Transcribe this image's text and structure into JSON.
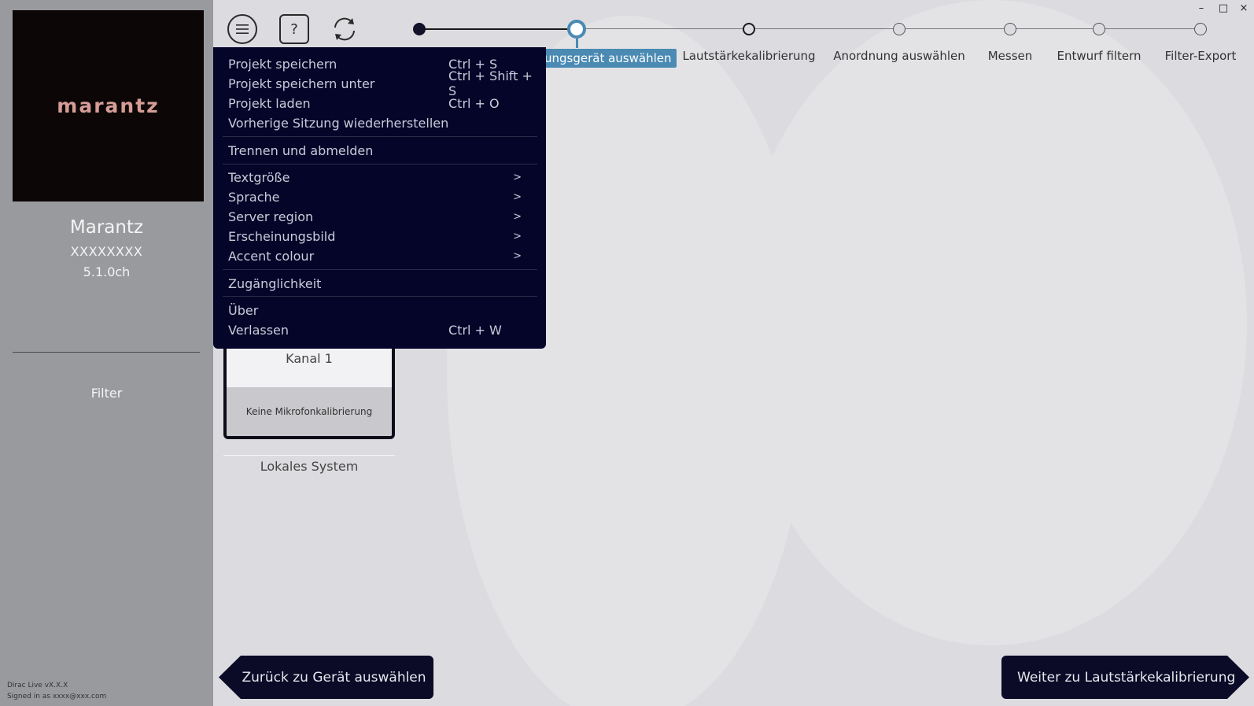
{
  "window": {
    "minimize": "–",
    "maximize": "□",
    "close": "×"
  },
  "sidebar": {
    "logo": "marantz",
    "device_name": "Marantz",
    "device_serial": "XXXXXXXX",
    "device_channels": "5.1.0ch",
    "filter_label": "Filter",
    "version": "Dirac Live vX.X.X",
    "signed_in": "Signed in as xxxx@xxx.com"
  },
  "toolbar": {
    "menu_icon": "hamburger-icon",
    "help_label": "?",
    "refresh_icon": "refresh-icon"
  },
  "stepper": {
    "steps": [
      {
        "label": "",
        "state": "done"
      },
      {
        "label": "ungsgerät auswählen",
        "state": "current"
      },
      {
        "label": "Lautstärkekalibrierung",
        "state": "next"
      },
      {
        "label": "Anordnung auswählen",
        "state": "todo"
      },
      {
        "label": "Messen",
        "state": "todo"
      },
      {
        "label": "Entwurf filtern",
        "state": "todo"
      },
      {
        "label": "Filter-Export",
        "state": "todo"
      }
    ]
  },
  "menu": {
    "items": [
      {
        "label": "Projekt speichern",
        "shortcut": "Ctrl + S"
      },
      {
        "label": "Projekt speichern unter",
        "shortcut": "Ctrl + Shift + S"
      },
      {
        "label": "Projekt laden",
        "shortcut": "Ctrl + O"
      },
      {
        "label": "Vorherige Sitzung wiederherstellen",
        "shortcut": ""
      },
      {
        "label": "Trennen und abmelden",
        "shortcut": ""
      },
      {
        "label": "Textgröße",
        "submenu": ">"
      },
      {
        "label": "Sprache",
        "submenu": ">"
      },
      {
        "label": "Server region",
        "submenu": ">"
      },
      {
        "label": "Erscheinungsbild",
        "submenu": ">"
      },
      {
        "label": "Accent colour",
        "submenu": ">"
      },
      {
        "label": "Zugänglichkeit",
        "shortcut": ""
      },
      {
        "label": "Über",
        "shortcut": ""
      },
      {
        "label": "Verlassen",
        "shortcut": "Ctrl + W"
      }
    ]
  },
  "channel": {
    "name": "Kanal 1",
    "calibration": "Keine Mikrofonkalibrierung",
    "system_label": "Lokales System"
  },
  "nav": {
    "back_label": "Zurück zu Gerät auswählen",
    "next_label": "Weiter zu Lautstärkekalibrierung"
  },
  "colors": {
    "accent": "#4a8ab3",
    "menu_bg": "#05052a",
    "sidebar_bg": "#999a9e",
    "logo_text": "#d59d96"
  }
}
